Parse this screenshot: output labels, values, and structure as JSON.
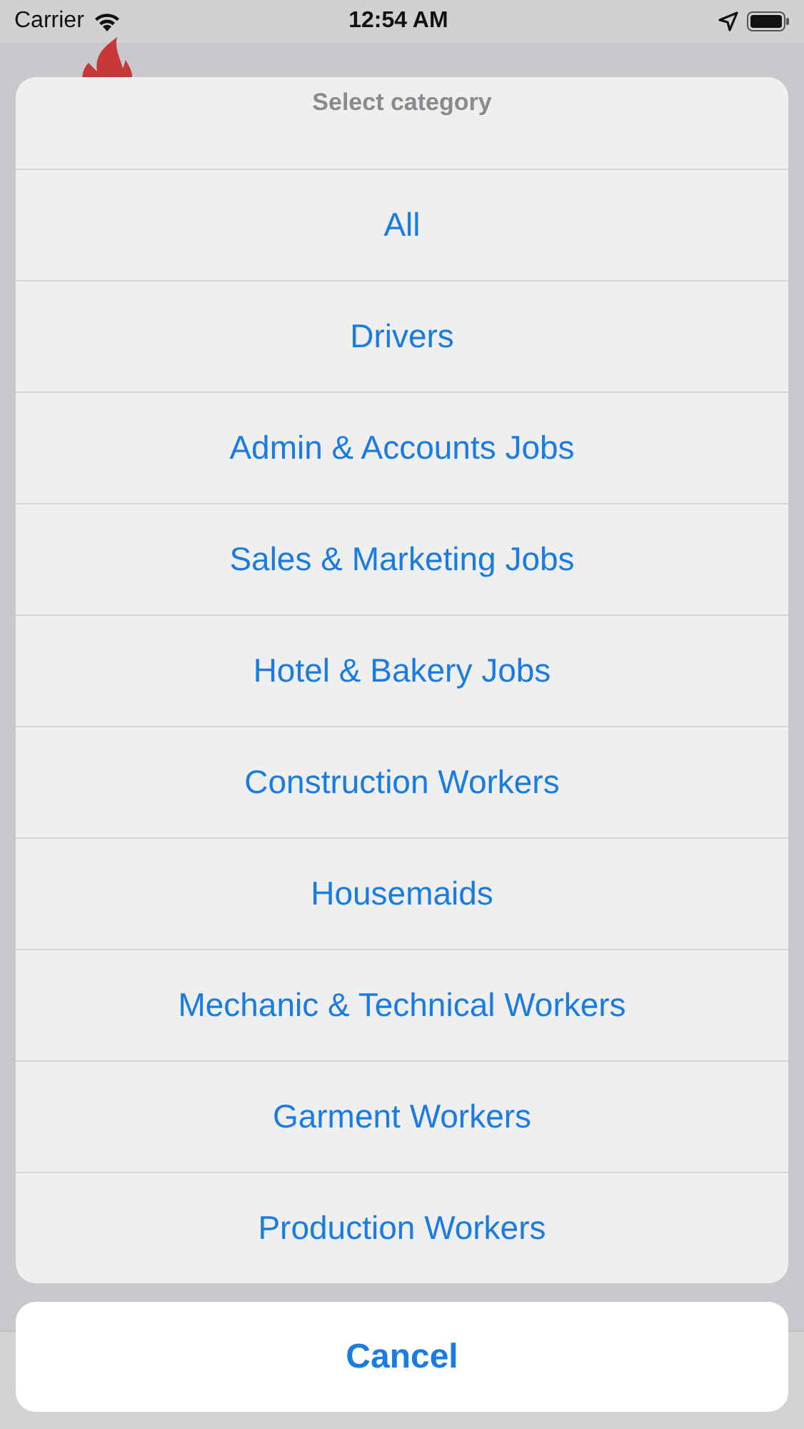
{
  "status_bar": {
    "carrier": "Carrier",
    "time": "12:54 AM"
  },
  "action_sheet": {
    "title": "Select category",
    "options": [
      "All",
      "Drivers",
      "Admin & Accounts Jobs",
      "Sales & Marketing Jobs",
      "Hotel & Bakery Jobs",
      "Construction Workers",
      "Housemaids",
      "Mechanic & Technical Workers",
      "Garment Workers",
      "Production Workers"
    ],
    "cancel": "Cancel"
  }
}
